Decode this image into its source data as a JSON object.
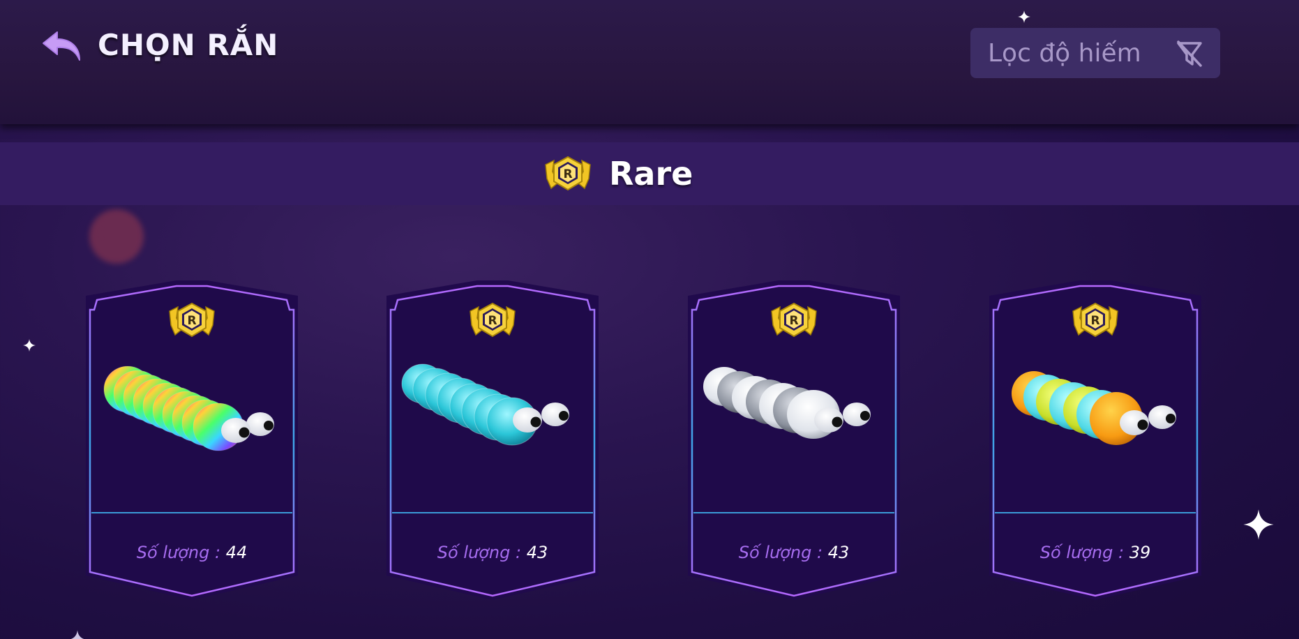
{
  "header": {
    "title": "CHỌN RẮN",
    "filter_label": "Lọc độ hiếm"
  },
  "rarity": {
    "title": "Rare",
    "badge_letter": "R"
  },
  "cards": [
    {
      "quantity_label": "Số lượng :",
      "quantity": "44",
      "skin": "rainbow"
    },
    {
      "quantity_label": "Số lượng :",
      "quantity": "43",
      "skin": "cyan"
    },
    {
      "quantity_label": "Số lượng :",
      "quantity": "43",
      "skin": "grey-white"
    },
    {
      "quantity_label": "Số lượng :",
      "quantity": "39",
      "skin": "citrus"
    }
  ],
  "colors": {
    "accent_purple": "#a76df0",
    "gold": "#f2c524",
    "banner": "#341c61",
    "card_fill": "#1f0a4a"
  },
  "icons": {
    "back": "back-arrow-icon",
    "filter": "filter-off-icon",
    "rarity": "rare-badge-icon"
  }
}
